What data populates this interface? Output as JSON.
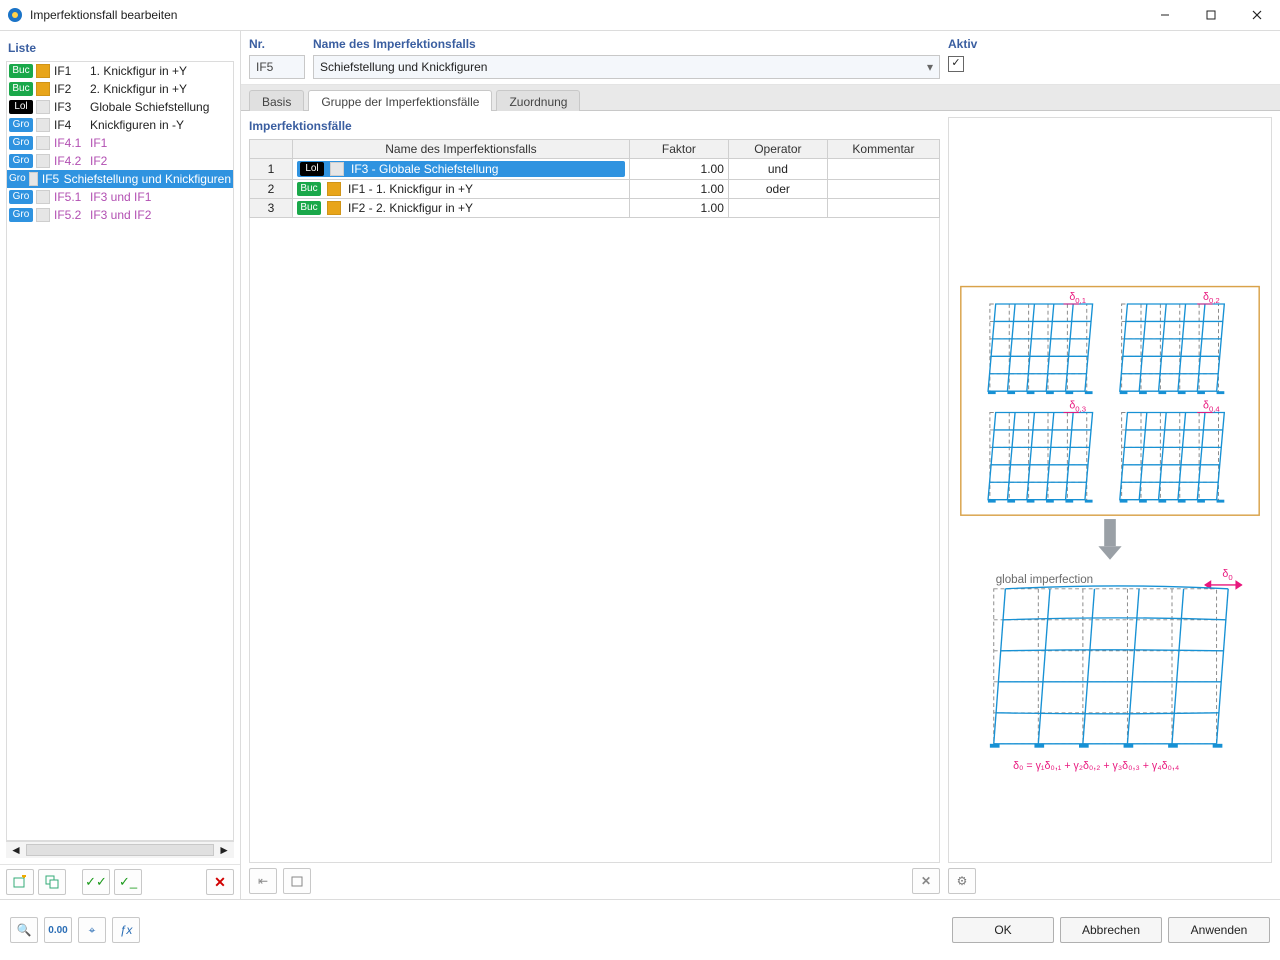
{
  "window": {
    "title": "Imperfektionsfall bearbeiten"
  },
  "sidebar": {
    "heading": "Liste",
    "items": [
      {
        "tag": "Buc",
        "tagcls": "buc",
        "swatch": "gold",
        "id": "IF1",
        "name": "1. Knickfigur in +Y"
      },
      {
        "tag": "Buc",
        "tagcls": "buc",
        "swatch": "gold",
        "id": "IF2",
        "name": "2. Knickfigur in +Y"
      },
      {
        "tag": "Lol",
        "tagcls": "lol",
        "swatch": "plain",
        "id": "IF3",
        "name": "Globale Schiefstellung"
      },
      {
        "tag": "Gro",
        "tagcls": "gro",
        "swatch": "plain",
        "id": "IF4",
        "name": "Knickfiguren in -Y"
      },
      {
        "tag": "Gro",
        "tagcls": "gro",
        "swatch": "plain",
        "id": "IF4.1",
        "name": "IF1",
        "child": true
      },
      {
        "tag": "Gro",
        "tagcls": "gro",
        "swatch": "plain",
        "id": "IF4.2",
        "name": "IF2",
        "child": true
      },
      {
        "tag": "Gro",
        "tagcls": "gro",
        "swatch": "plain",
        "id": "IF5",
        "name": "Schiefstellung und Knickfiguren",
        "selected": true
      },
      {
        "tag": "Gro",
        "tagcls": "gro",
        "swatch": "plain",
        "id": "IF5.1",
        "name": "IF3 und IF1",
        "child": true
      },
      {
        "tag": "Gro",
        "tagcls": "gro",
        "swatch": "plain",
        "id": "IF5.2",
        "name": "IF3 und IF2",
        "child": true
      }
    ]
  },
  "top": {
    "nr_label": "Nr.",
    "nr_value": "IF5",
    "name_label": "Name des Imperfektionsfalls",
    "name_value": "Schiefstellung und Knickfiguren",
    "active_label": "Aktiv",
    "active_checked": true
  },
  "tabs": {
    "t1": "Basis",
    "t2": "Gruppe der Imperfektionsfälle",
    "t3": "Zuordnung"
  },
  "cases": {
    "heading": "Imperfektionsfälle",
    "cols": {
      "name": "Name des Imperfektionsfalls",
      "factor": "Faktor",
      "op": "Operator",
      "comment": "Kommentar"
    },
    "rows": [
      {
        "n": "1",
        "tag": "Lol",
        "tagcls": "lol",
        "swatch": "plain",
        "text": "IF3 - Globale Schiefstellung",
        "factor": "1.00",
        "op": "und",
        "sel": true
      },
      {
        "n": "2",
        "tag": "Buc",
        "tagcls": "buc",
        "swatch": "gold",
        "text": "IF1 - 1. Knickfigur in +Y",
        "factor": "1.00",
        "op": "oder"
      },
      {
        "n": "3",
        "tag": "Buc",
        "tagcls": "buc",
        "swatch": "gold",
        "text": "IF2 - 2. Knickfigur in +Y",
        "factor": "1.00",
        "op": ""
      }
    ]
  },
  "diagram": {
    "d1": "δ",
    "s01": "0,1",
    "s02": "0,2",
    "s03": "0,3",
    "s04": "0,4",
    "s0": "0",
    "gi": "global imperfection",
    "formula": "δ₀ = γ₁δ₀,₁ + γ₂δ₀,₂ + γ₃δ₀,₃ + γ₄δ₀,₄"
  },
  "buttons": {
    "ok": "OK",
    "cancel": "Abbrechen",
    "apply": "Anwenden"
  }
}
